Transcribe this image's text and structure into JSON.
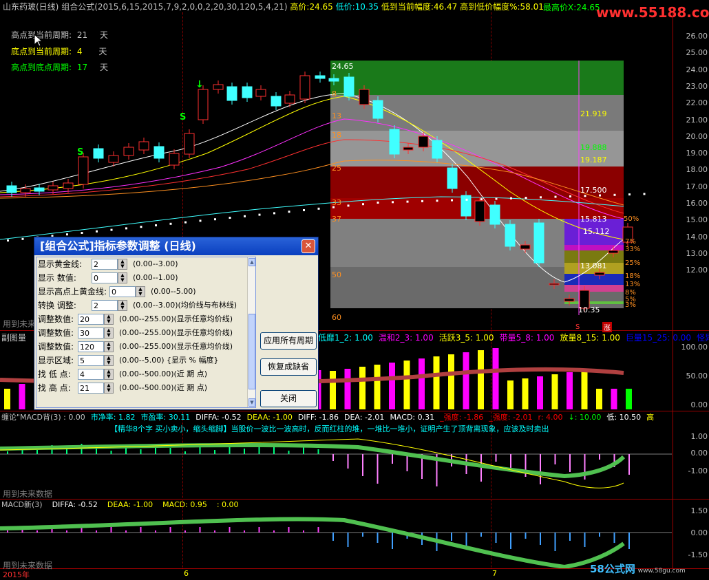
{
  "header": {
    "title": "山东药玻(日线)",
    "formula": "组合公式(2015,6,15,2015,7,9,2,0,0,2,20,30,120,5,4,21)",
    "high_label": "高价:",
    "high_value": "24.65",
    "low_label": "低价:",
    "low_value": "10.35",
    "from_low_label": "低到当前幅度:",
    "from_low_value": "46.47",
    "high_low_label": "高到低价幅度%:",
    "high_low_value": "58.01",
    "max_price_label": "最高价X:",
    "max_price_value": "24.65",
    "watermark": "www.55188.com"
  },
  "periods": [
    {
      "label": "高点到当前周期:",
      "value": "21",
      "unit": "天"
    },
    {
      "label": "底点到当前周期:",
      "value": "4",
      "unit": "天"
    },
    {
      "label": "高点到底点周期:",
      "value": "17",
      "unit": "天"
    }
  ],
  "price_axis": [
    "26.00",
    "25.00",
    "24.00",
    "23.00",
    "22.00",
    "21.00",
    "20.00",
    "19.00",
    "18.00",
    "17.00",
    "16.00",
    "15.00",
    "14.00",
    "13.00",
    "12.00"
  ],
  "fib_left": [
    "24.65",
    "8",
    "13",
    "18",
    "25",
    "33",
    "37",
    "50",
    "60"
  ],
  "fib_right": [
    {
      "text": "21.919",
      "color": "#ffff00"
    },
    {
      "text": "19.888",
      "color": "#00ff00"
    },
    {
      "text": "19.187",
      "color": "#ffff00"
    },
    {
      "text": "17.500",
      "color": "#ffffff"
    },
    {
      "text": "15.813",
      "color": "#ffffff"
    },
    {
      "text": "15.112",
      "color": "#ffffff"
    },
    {
      "text": "13.081",
      "color": "#ffffff"
    },
    {
      "text": "10.35",
      "color": "#ffffff"
    }
  ],
  "fib_pct": [
    "50%",
    "7%",
    "33%",
    "25%",
    "18%",
    "13%",
    "8%",
    "5%",
    "3%"
  ],
  "main_markers": {
    "sell": "S",
    "s2": "S",
    "arrow": "↓",
    "bottom_s": "S",
    "bottom_zhang": "涨"
  },
  "future_labels": [
    "用到未来数据",
    "用到未来数据",
    "用到未来数据"
  ],
  "sub1": {
    "title": "副图量",
    "items": [
      {
        "text": "低靡1_2: 1.00",
        "color": "#00ffff"
      },
      {
        "text": "温和2_3: 1.00",
        "color": "#ff00ff"
      },
      {
        "text": "活跃3_5: 1.00",
        "color": "#ffff00"
      },
      {
        "text": "带量5_8: 1.00",
        "color": "#ff00ff"
      },
      {
        "text": "放量8_15: 1.00",
        "color": "#ffff00"
      },
      {
        "text": "巨量15_25: 0.00",
        "color": "#0000ff"
      },
      {
        "text": "怪异",
        "color": "#0000ff"
      }
    ],
    "axis": [
      "100.00",
      "50.00",
      "0.00"
    ]
  },
  "sub2": {
    "row1": [
      {
        "text": "缠论\"MACD背(3) : 0.00",
        "color": "#c0c0c0"
      },
      {
        "text": "市净率: 1.82",
        "color": "#00ffff"
      },
      {
        "text": "市盈率: 30.11",
        "color": "#00ffff"
      },
      {
        "text": "DIFFA: -0.52",
        "color": "#ffffff"
      },
      {
        "text": "DEAA: -1.00",
        "color": "#ffff00"
      },
      {
        "text": "DIFF: -1.86",
        "color": "#ffffff"
      },
      {
        "text": "DEA: -2.01",
        "color": "#ffffff"
      },
      {
        "text": "MACD: 0.31",
        "color": "#ffffff"
      },
      {
        "text": "_强度: -1.86",
        "color": "#ff0000"
      },
      {
        "text": "_强度: -2.01",
        "color": "#ff0000"
      },
      {
        "text": "r: 4.00",
        "color": "#ff0000"
      },
      {
        "text": "↓: 10.00",
        "color": "#00ff00"
      },
      {
        "text": "低: 10.50",
        "color": "#ffffff"
      },
      {
        "text": "高",
        "color": "#ffff00"
      }
    ],
    "note": "【精华8个字 买小卖小，缩头缩脚】当股价一波比一波高时，反而红柱的堆，一堆比一堆小，证明产生了顶背离现象，应该及时卖出",
    "axis": [
      "1.00",
      "0.00",
      "-1.00"
    ]
  },
  "sub3": {
    "row": [
      {
        "text": "MACD新(3)",
        "color": "#c0c0c0"
      },
      {
        "text": "DIFFA: -0.52",
        "color": "#ffffff"
      },
      {
        "text": "DEAA: -1.00",
        "color": "#ffff00"
      },
      {
        "text": "MACD: 0.95",
        "color": "#ffff00"
      },
      {
        "text": ": 0.00",
        "color": "#ffff00"
      }
    ],
    "axis": [
      "1.50",
      "0.00",
      "-1.50"
    ]
  },
  "date_axis": {
    "year": "2015年",
    "m6": "6",
    "m7": "7"
  },
  "footer_logo": {
    "main": "58公式网",
    "url": "www.58gu.com"
  },
  "dialog": {
    "title": "[组合公式]指标参数调整 (日线)",
    "close": "✕",
    "params": [
      {
        "label": "显示黄金线:",
        "value": "2",
        "range": "(0.00--3.00)"
      },
      {
        "label": "显示  数值:",
        "value": "0",
        "range": "(0.00--1.00)"
      },
      {
        "label": "显示高点上黄金线:",
        "value": "0",
        "range": "(0.00--5.00)"
      },
      {
        "label": "转换  调整:",
        "value": "2",
        "range": "(0.00--3.00)(均价线与布林线)"
      },
      {
        "label": "调整数值:",
        "value": "20",
        "range": "(0.00--255.00)(显示任意均价线)"
      },
      {
        "label": "调整数值:",
        "value": "30",
        "range": "(0.00--255.00)(显示任意均价线)"
      },
      {
        "label": "调整数值:",
        "value": "120",
        "range": "(0.00--255.00)(显示任意均价线)"
      },
      {
        "label": "显示区域:",
        "value": "5",
        "range": "(0.00--5.00) {显示 % 幅度}"
      },
      {
        "label": "找 低 点:",
        "value": "4",
        "range": "(0.00--500.00)(近 期 点)"
      },
      {
        "label": "找 高 点:",
        "value": "21",
        "range": "(0.00--500.00)(近 期 点)"
      }
    ],
    "btn_apply_all": "应用所有周期",
    "btn_restore": "恢复成缺省",
    "btn_close": "关闭"
  }
}
